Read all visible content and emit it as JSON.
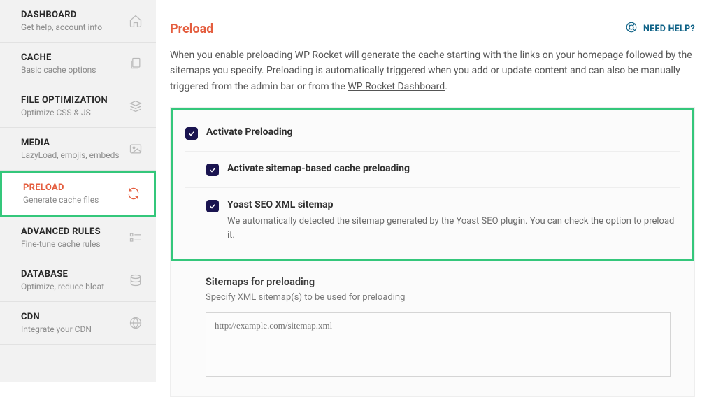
{
  "sidebar": {
    "items": [
      {
        "title": "DASHBOARD",
        "sub": "Get help, account info",
        "icon": "home"
      },
      {
        "title": "CACHE",
        "sub": "Basic cache options",
        "icon": "copy"
      },
      {
        "title": "FILE OPTIMIZATION",
        "sub": "Optimize CSS & JS",
        "icon": "layers"
      },
      {
        "title": "MEDIA",
        "sub": "LazyLoad, emojis, embeds",
        "icon": "image"
      },
      {
        "title": "PRELOAD",
        "sub": "Generate cache files",
        "icon": "refresh",
        "active": true
      },
      {
        "title": "ADVANCED RULES",
        "sub": "Fine-tune cache rules",
        "icon": "list"
      },
      {
        "title": "DATABASE",
        "sub": "Optimize, reduce bloat",
        "icon": "database"
      },
      {
        "title": "CDN",
        "sub": "Integrate your CDN",
        "icon": "globe"
      }
    ]
  },
  "page": {
    "title": "Preload",
    "help_label": "NEED HELP?",
    "intro_before": "When you enable preloading WP Rocket will generate the cache starting with the links on your homepage followed by the sitemaps you specify. Preloading is automatically triggered when you add or update content and can also be manually triggered from the admin bar or from the ",
    "intro_link": "WP Rocket Dashboard",
    "intro_after": "."
  },
  "options": {
    "activate_preloading": {
      "label": "Activate Preloading",
      "checked": true
    },
    "activate_sitemap": {
      "label": "Activate sitemap-based cache preloading",
      "checked": true
    },
    "yoast": {
      "label": "Yoast SEO XML sitemap",
      "desc": "We automatically detected the sitemap generated by the Yoast SEO plugin. You can check the option to preload it.",
      "checked": true
    }
  },
  "sitemaps": {
    "title": "Sitemaps for preloading",
    "desc": "Specify XML sitemap(s) to be used for preloading",
    "placeholder": "http://example.com/sitemap.xml",
    "value": ""
  }
}
